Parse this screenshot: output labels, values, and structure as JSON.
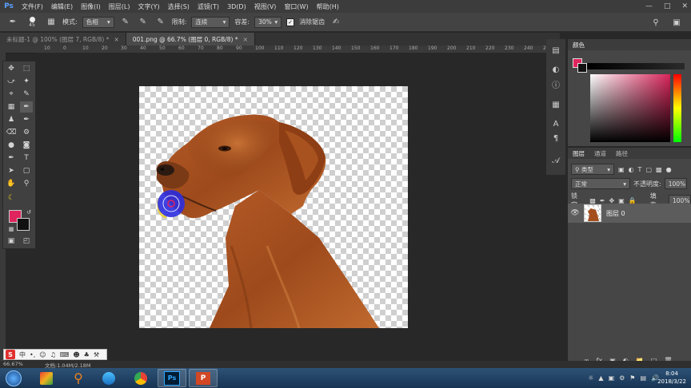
{
  "menubar": {
    "items": [
      "文件(F)",
      "编辑(E)",
      "图像(I)",
      "图层(L)",
      "文字(Y)",
      "选择(S)",
      "滤镜(T)",
      "3D(D)",
      "视图(V)",
      "窗口(W)",
      "帮助(H)"
    ],
    "app_logo": "Ps"
  },
  "options": {
    "brush_size": "45",
    "mode_label": "模式:",
    "mode_value": "色相",
    "limits_label": "限制:",
    "limits_value": "连续",
    "tolerance_label": "容差:",
    "tolerance_value": "30%",
    "antialias_label": "消除锯齿",
    "antialias_checked": true
  },
  "tabs": [
    {
      "label": "未标题-1 @ 100% (图层 7, RGB/8) *",
      "active": false
    },
    {
      "label": "001.png @ 66.7% (图层 0, RGB/8) *",
      "active": true
    }
  ],
  "ruler_top": [
    "10",
    "0",
    "10",
    "20",
    "30",
    "40",
    "50",
    "60",
    "70",
    "80",
    "90",
    "100",
    "110",
    "120",
    "130",
    "140",
    "150",
    "160",
    "170",
    "180",
    "190",
    "200",
    "210",
    "220",
    "230",
    "240",
    "250"
  ],
  "color_panel": {
    "tab": "颜色",
    "foreground": "#e0245e",
    "background": "#111111"
  },
  "layers_panel": {
    "tabs": [
      "图层",
      "通道",
      "路径"
    ],
    "filter_label": "类型",
    "blend_mode": "正常",
    "opacity_label": "不透明度:",
    "opacity_value": "100%",
    "lock_label": "锁定:",
    "fill_label": "填充:",
    "fill_value": "100%",
    "layers": [
      {
        "name": "图层 0",
        "visible": true
      }
    ]
  },
  "status": {
    "zoom": "66.67%",
    "doc_info": "文档:1.04M/2.18M"
  },
  "ime": {
    "label": "中"
  },
  "taskbar": {
    "time": "8:04",
    "date": "2018/3/22"
  }
}
